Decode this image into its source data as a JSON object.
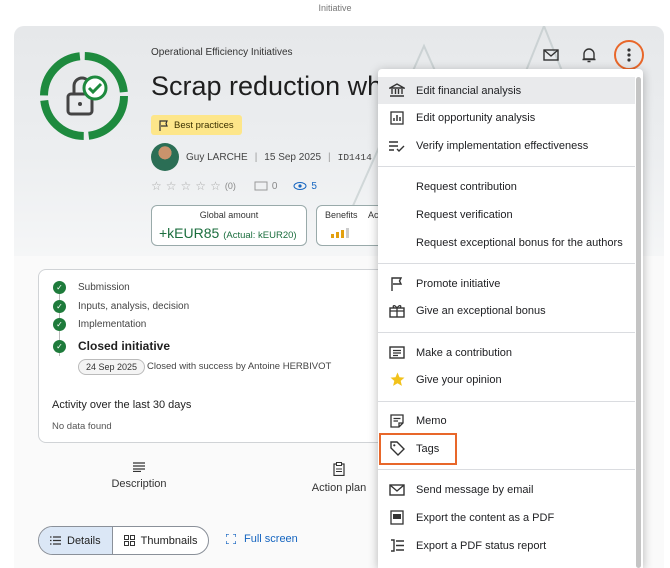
{
  "window": {
    "top_label": "Initiative"
  },
  "header": {
    "category": "Operational Efficiency Initiatives",
    "title": "Scrap reduction whe",
    "badge": "Best practices",
    "author": "Guy LARCHE",
    "date": "15 Sep 2025",
    "id": "ID1414",
    "rating_count": "(0)",
    "comments": "0",
    "views": "5"
  },
  "amount": {
    "label": "Global amount",
    "value": "+kEUR85",
    "actual": "(Actual: kEUR20)"
  },
  "benefits": {
    "label": "Benefits",
    "next_label": "Ac"
  },
  "timeline": {
    "steps": [
      "Submission",
      "Inputs, analysis, decision",
      "Implementation"
    ],
    "closed_label": "Closed initiative",
    "closed_date": "24 Sep 2025",
    "closed_text": "Closed with success by Antoine HERBIVOT"
  },
  "activity": {
    "title": "Activity over the last 30 days",
    "empty": "No data found"
  },
  "tabs": {
    "description": "Description",
    "action_plan": "Action plan"
  },
  "view_toggle": {
    "details": "Details",
    "thumbnails": "Thumbnails",
    "full_screen": "Full screen"
  },
  "menu": {
    "items": [
      {
        "label": "Edit financial analysis",
        "icon": "bank-icon"
      },
      {
        "label": "Edit opportunity analysis",
        "icon": "chart-box-icon"
      },
      {
        "label": "Verify implementation effectiveness",
        "icon": "checklist-icon"
      },
      {
        "label": "Request contribution",
        "icon": ""
      },
      {
        "label": "Request verification",
        "icon": ""
      },
      {
        "label": "Request exceptional bonus for the authors",
        "icon": ""
      },
      {
        "label": "Promote initiative",
        "icon": "flag-icon"
      },
      {
        "label": "Give an exceptional bonus",
        "icon": "gift-icon"
      },
      {
        "label": "Make a contribution",
        "icon": "comment-icon"
      },
      {
        "label": "Give your opinion",
        "icon": "star-icon"
      },
      {
        "label": "Memo",
        "icon": "memo-icon"
      },
      {
        "label": "Tags",
        "icon": "tag-icon"
      },
      {
        "label": "Send message by email",
        "icon": "email-icon"
      },
      {
        "label": "Export the content as a PDF",
        "icon": "pdf-icon"
      },
      {
        "label": "Export a PDF status report",
        "icon": "report-icon"
      }
    ]
  },
  "colors": {
    "accent_green": "#1e7b3b",
    "badge_yellow": "#fde68a",
    "highlight_orange": "#e8672a",
    "link_blue": "#1565c0"
  }
}
